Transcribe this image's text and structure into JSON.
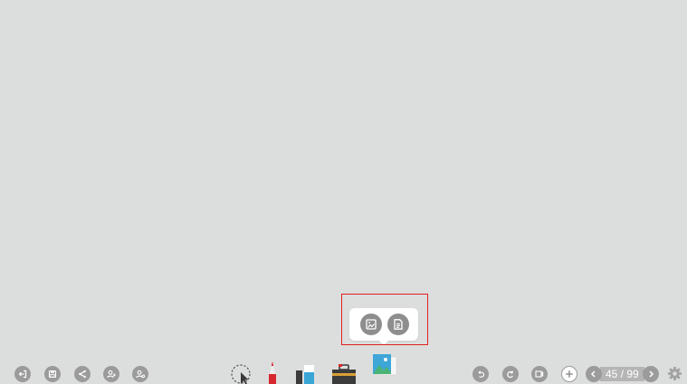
{
  "canvas": {
    "background": "#dcdedd"
  },
  "left_toolbar": [
    {
      "name": "exit-icon"
    },
    {
      "name": "save-icon"
    },
    {
      "name": "share-icon"
    },
    {
      "name": "add-user-icon"
    },
    {
      "name": "user-settings-icon"
    }
  ],
  "center_tools": [
    {
      "name": "select-tool-icon"
    },
    {
      "name": "pen-tool-icon"
    },
    {
      "name": "eraser-tool-icon"
    },
    {
      "name": "toolbox-icon"
    },
    {
      "name": "insert-media-icon"
    }
  ],
  "insert_popup": {
    "items": [
      {
        "name": "insert-image-icon"
      },
      {
        "name": "insert-document-icon"
      }
    ],
    "highlight_color": "#e02020"
  },
  "right_toolbar": [
    {
      "name": "undo-icon"
    },
    {
      "name": "redo-icon"
    },
    {
      "name": "page-view-icon"
    },
    {
      "name": "add-page-icon"
    }
  ],
  "pagination": {
    "label": "45 / 99",
    "current": 45,
    "total": 99
  },
  "settings": {
    "name": "settings-gear-icon"
  }
}
